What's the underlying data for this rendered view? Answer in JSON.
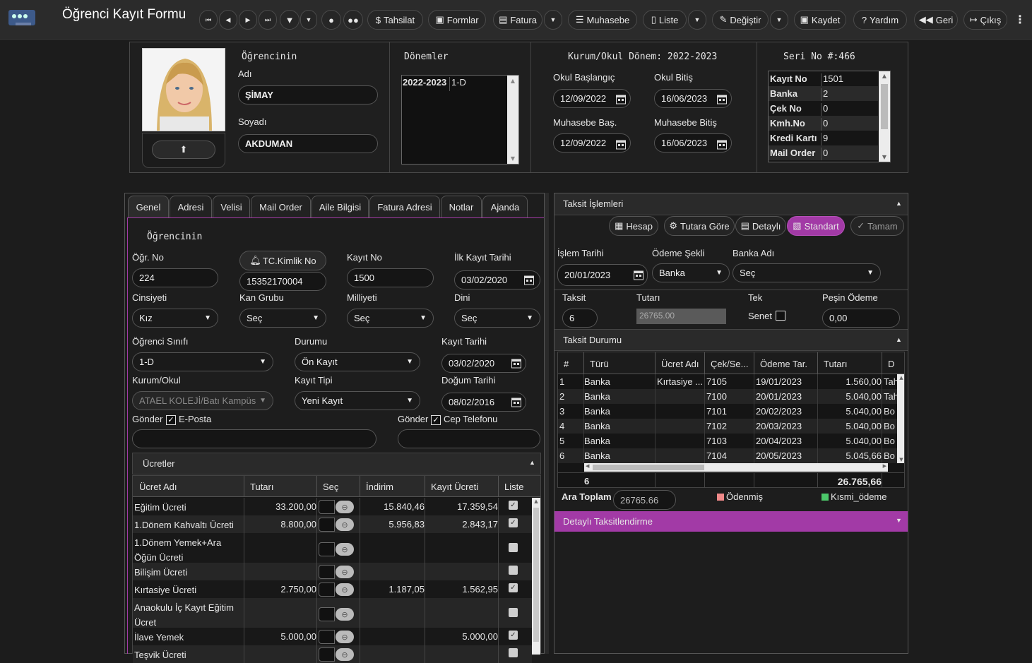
{
  "app": {
    "title": "Öğrenci Kayıt Formu"
  },
  "toolbar": {
    "tahsilat": "Tahsilat",
    "formlar": "Formlar",
    "fatura": "Fatura",
    "muhasebe": "Muhasebe",
    "liste": "Liste",
    "degistir": "Değiştir",
    "kaydet": "Kaydet",
    "yardim": "Yardım",
    "geri": "Geri",
    "cikis": "Çıkış"
  },
  "student": {
    "section_label": "Öğrencinin",
    "name_label": "Adı",
    "name": "ŞİMAY",
    "surname_label": "Soyadı",
    "surname": "AKDUMAN"
  },
  "donemler": {
    "title": "Dönemler",
    "rows": [
      {
        "year": "2022-2023",
        "class": "1-D"
      }
    ]
  },
  "kurum": {
    "title": "Kurum/Okul Dönem: 2022-2023",
    "okul_bas_label": "Okul Başlangıç",
    "okul_bas": "12/09/2022",
    "okul_bit_label": "Okul Bitiş",
    "okul_bit": "16/06/2023",
    "muh_bas_label": "Muhasebe Baş.",
    "muh_bas": "12/09/2022",
    "muh_bit_label": "Muhasebe Bitiş",
    "muh_bit": "16/06/2023"
  },
  "seri": {
    "title": "Seri No #:466",
    "rows": [
      {
        "k": "Kayıt No",
        "v": "1501"
      },
      {
        "k": "Banka",
        "v": "2"
      },
      {
        "k": "Çek No",
        "v": "0"
      },
      {
        "k": "Kmh.No",
        "v": "0"
      },
      {
        "k": "Kredi Kartı",
        "v": "9"
      },
      {
        "k": "Mail Order",
        "v": "0"
      }
    ]
  },
  "tabs": [
    "Genel",
    "Adresi",
    "Velisi",
    "Mail Order",
    "Aile Bilgisi",
    "Fatura Adresi",
    "Notlar",
    "Ajanda"
  ],
  "genel": {
    "section_label": "Öğrencinin",
    "ogr_no_label": "Öğr. No",
    "ogr_no": "224",
    "tc_button": "TC.Kimlik No",
    "tc": "15352170004",
    "kayit_no_label": "Kayıt No",
    "kayit_no": "1500",
    "ilk_kayit_label": "İlk Kayıt Tarihi",
    "ilk_kayit": "03/02/2020",
    "cinsiyet_label": "Cinsiyeti",
    "cinsiyet": "Kız",
    "kan_label": "Kan Grubu",
    "kan": "Seç",
    "milliyet_label": "Milliyeti",
    "milliyet": "Seç",
    "dini_label": "Dini",
    "dini": "Seç",
    "sinif_label": "Öğrenci Sınıfı",
    "sinif": "1-D",
    "durum_label": "Durumu",
    "durum": "Ön Kayıt",
    "kayit_tarihi_label": "Kayıt Tarihi",
    "kayit_tarihi": "03/02/2020",
    "kurum_label": "Kurum/Okul",
    "kurum": "ATAEL KOLEJİ/Batı Kampüs",
    "kayit_tipi_label": "Kayıt Tipi",
    "kayit_tipi": "Yeni Kayıt",
    "dogum_label": "Doğum Tarihi",
    "dogum": "08/02/2016",
    "gonder1": "Gönder",
    "eposta": "E-Posta",
    "gonder2": "Gönder",
    "cep": "Cep Telefonu"
  },
  "ucretler": {
    "title": "Ücretler",
    "headers": [
      "Ücret Adı",
      "Tutarı",
      "Seç",
      "İndirim",
      "Kayıt Ücreti",
      "Liste"
    ],
    "rows": [
      {
        "ad": "Eğitim Ücreti",
        "ad2": "",
        "tutar": "33.200,00",
        "indirim": "15.840,46",
        "kayit": "17.359,54",
        "liste": true
      },
      {
        "ad": "1.Dönem Kahvaltı Ücreti",
        "ad2": "",
        "tutar": "8.800,00",
        "indirim": "5.956,83",
        "kayit": "2.843,17",
        "liste": true
      },
      {
        "ad": "1.Dönem Yemek+Ara",
        "ad2": "Öğün Ücreti",
        "tutar": "",
        "indirim": "",
        "kayit": "",
        "liste": false
      },
      {
        "ad": "Bilişim Ücreti",
        "ad2": "",
        "tutar": "",
        "indirim": "",
        "kayit": "",
        "liste": false
      },
      {
        "ad": "Kırtasiye Ücreti",
        "ad2": "",
        "tutar": "2.750,00",
        "indirim": "1.187,05",
        "kayit": "1.562,95",
        "liste": true
      },
      {
        "ad": "Anaokulu İç Kayıt Eğitim",
        "ad2": "Ücret",
        "tutar": "",
        "indirim": "",
        "kayit": "",
        "liste": false
      },
      {
        "ad": "İlave Yemek",
        "ad2": "",
        "tutar": "5.000,00",
        "indirim": "",
        "kayit": "5.000,00",
        "liste": true
      },
      {
        "ad": "Teşvik Ücreti",
        "ad2": "",
        "tutar": "",
        "indirim": "",
        "kayit": "",
        "liste": false
      }
    ]
  },
  "taksit": {
    "title": "Taksit İşlemleri",
    "btn_hesap": "Hesap",
    "btn_tutara": "Tutara Göre",
    "btn_detayli": "Detaylı",
    "btn_standart": "Standart",
    "btn_tamam": "Tamam",
    "islem_label": "İşlem Tarihi",
    "islem": "20/01/2023",
    "odeme_label": "Ödeme Şekli",
    "odeme": "Banka",
    "banka_label": "Banka Adı",
    "banka": "Seç",
    "taksit_label": "Taksit",
    "taksit": "6",
    "tutar_label": "Tutarı",
    "tutar": "26765.00",
    "tek_label": "Tek",
    "senet_label": "Senet",
    "pesin_label": "Peşin Ödeme",
    "pesin": "0,00"
  },
  "durum": {
    "title": "Taksit Durumu",
    "headers": [
      "#",
      "Türü",
      "Ücret Adı",
      "Çek/Se...",
      "Ödeme Tar.",
      "Tutarı",
      "D"
    ],
    "rows": [
      {
        "n": "1",
        "tur": "Banka",
        "ucret": "Kırtasiye ...",
        "cek": "7105",
        "tarih": "19/01/2023",
        "tutar": "1.560,00",
        "d": "Tah"
      },
      {
        "n": "2",
        "tur": "Banka",
        "ucret": "",
        "cek": "7100",
        "tarih": "20/01/2023",
        "tutar": "5.040,00",
        "d": "Tah"
      },
      {
        "n": "3",
        "tur": "Banka",
        "ucret": "",
        "cek": "7101",
        "tarih": "20/02/2023",
        "tutar": "5.040,00",
        "d": "Bo"
      },
      {
        "n": "4",
        "tur": "Banka",
        "ucret": "",
        "cek": "7102",
        "tarih": "20/03/2023",
        "tutar": "5.040,00",
        "d": "Bo"
      },
      {
        "n": "5",
        "tur": "Banka",
        "ucret": "",
        "cek": "7103",
        "tarih": "20/04/2023",
        "tutar": "5.040,00",
        "d": "Bo"
      },
      {
        "n": "6",
        "tur": "Banka",
        "ucret": "",
        "cek": "7104",
        "tarih": "20/05/2023",
        "tutar": "5.045,66",
        "d": "Bo"
      }
    ],
    "footer_count": "6",
    "footer_total": "26.765,66",
    "ara_label": "Ara Toplam",
    "ara": "26765.66",
    "odenmis": "Ödenmiş",
    "kismi": "Kısmi_ödeme",
    "detayli": "Detaylı Taksitlendirme"
  },
  "colors": {
    "accent": "#a23aa6",
    "odenmis": "#f08a8a",
    "kismi": "#4cc86a"
  }
}
